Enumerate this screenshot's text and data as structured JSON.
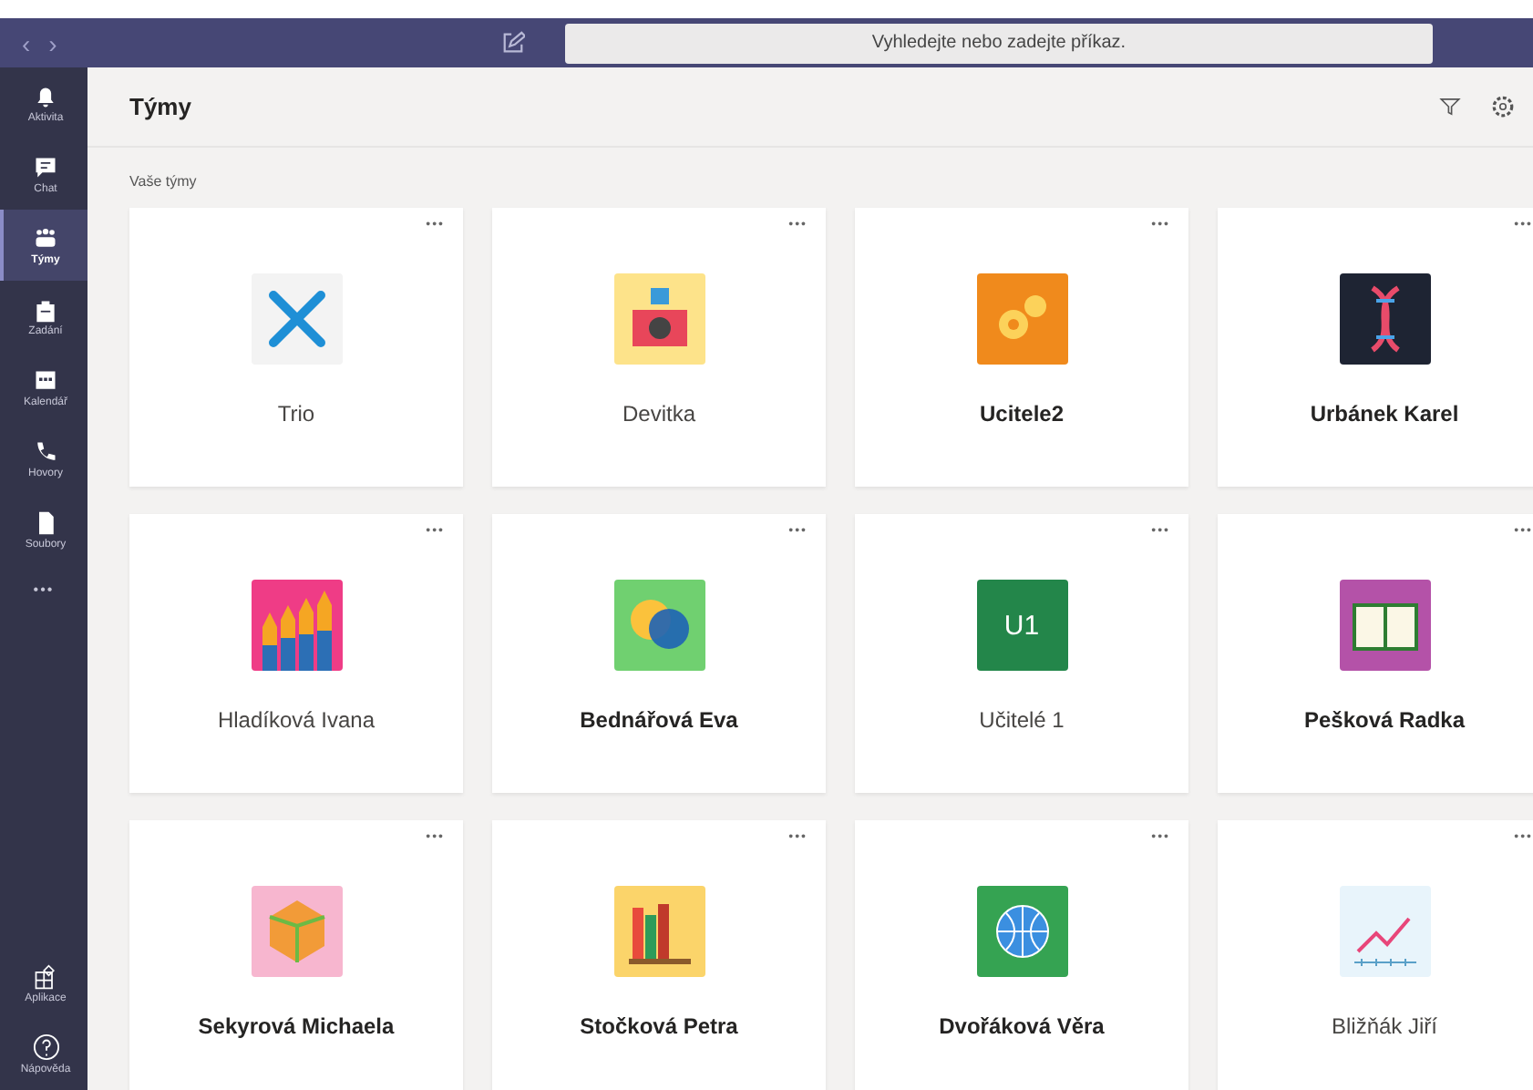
{
  "titlebar": {
    "back": "‹",
    "forward": "›",
    "search": {
      "placeholder": "Vyhledejte nebo zadejte příkaz."
    }
  },
  "rail": [
    {
      "label": "Aktivita",
      "kind": "bell",
      "selected": false
    },
    {
      "label": "Chat",
      "kind": "chat",
      "selected": false
    },
    {
      "label": "Týmy",
      "kind": "teams",
      "selected": true
    },
    {
      "label": "Zadání",
      "kind": "bag",
      "selected": false
    },
    {
      "label": "Kalendář",
      "kind": "calendar",
      "selected": false
    },
    {
      "label": "Hovory",
      "kind": "phone",
      "selected": false
    },
    {
      "label": "Soubory",
      "kind": "file",
      "selected": false
    }
  ],
  "rail_more": "•••",
  "rail_bottom": [
    {
      "label": "Aplikace",
      "kind": "apps"
    },
    {
      "label": "Nápověda",
      "kind": "help"
    }
  ],
  "header": {
    "title": "Týmy"
  },
  "section": "Vaše týmy",
  "teams": [
    {
      "name": "Trio",
      "kind": "tools",
      "bold": false
    },
    {
      "name": "Devitka",
      "kind": "camera",
      "bold": false
    },
    {
      "name": "Ucitele2",
      "kind": "gears",
      "bold": true
    },
    {
      "name": "Urbánek Karel",
      "kind": "dna",
      "bold": true
    },
    {
      "name": "Hladíková Ivana",
      "kind": "pencils",
      "bold": false
    },
    {
      "name": "Bednářová Eva",
      "kind": "bubbles",
      "bold": true
    },
    {
      "name": "Učitelé 1",
      "kind": "initials",
      "initials": "U1",
      "bold": false
    },
    {
      "name": "Pešková Radka",
      "kind": "book",
      "bold": true
    },
    {
      "name": "Sekyrová Michaela",
      "kind": "polyhedron",
      "bold": true
    },
    {
      "name": "Stočková Petra",
      "kind": "books",
      "bold": true
    },
    {
      "name": "Dvořáková Věra",
      "kind": "globe",
      "bold": true
    },
    {
      "name": "Bližňák Jiří",
      "kind": "chart",
      "bold": false
    }
  ],
  "more": "•••"
}
